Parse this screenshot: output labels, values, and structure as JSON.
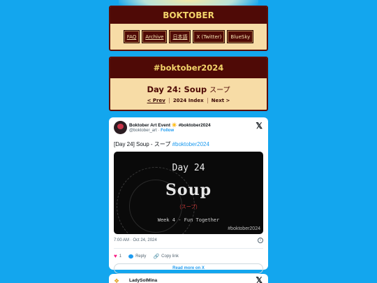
{
  "header": {
    "title": "BOKTOBER"
  },
  "nav": [
    {
      "label": "FAQ",
      "underline": true
    },
    {
      "label": "Archive",
      "underline": true
    },
    {
      "label": "日本語",
      "underline": true
    },
    {
      "label": "X (Twitter)",
      "underline": false
    },
    {
      "label": "BlueSky",
      "underline": false
    }
  ],
  "hashtag_panel": {
    "title": "#boktober2024",
    "day_title": "Day 24: Soup",
    "day_title_jp": "スープ",
    "prev_label": "< Prev",
    "index_label": "2024 Index",
    "next_label": "Next >"
  },
  "tweet": {
    "author_name": "Boktober Art Event ☀️ #boktober2024",
    "author_handle": "@boktober_art",
    "follow_label": "Follow",
    "text_prefix": "[Day 24] Soup - スープ ",
    "text_hashtag": "#boktober2024",
    "image": {
      "day": "Day 24",
      "word": "Soup",
      "word_jp": "(スープ)",
      "week": "Week 4 - Fun Together",
      "tag": "#boktober2024"
    },
    "timestamp": "7:00 AM · Oct 24, 2024",
    "likes": "1",
    "reply_label": "Reply",
    "copy_label": "Copy link",
    "read_more_label": "Read more on X"
  },
  "tweet2": {
    "author_name": "LadySolMina"
  },
  "colors": {
    "background": "#13a6ee",
    "panel_dark": "#4f0a06",
    "panel_light": "#f7dca6",
    "title_gold": "#f3d46a",
    "link_blue": "#1d9bf0"
  }
}
